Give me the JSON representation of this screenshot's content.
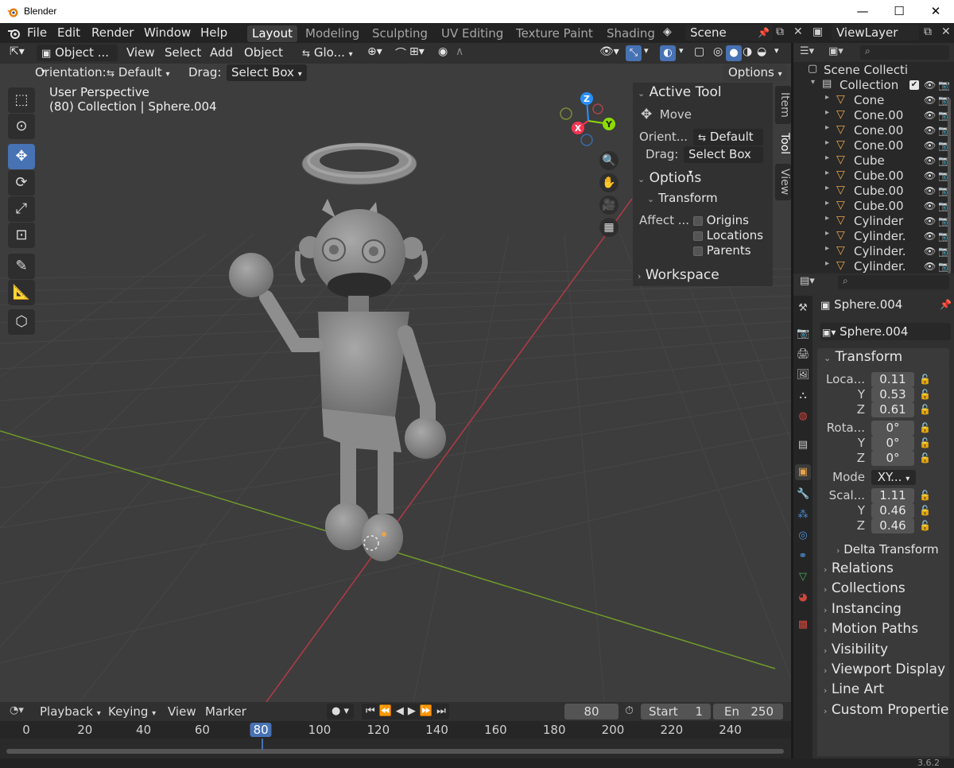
{
  "window": {
    "title": "Blender",
    "minimize": "—",
    "maximize": "☐",
    "close": "✕"
  },
  "menus": [
    "File",
    "Edit",
    "Render",
    "Window",
    "Help"
  ],
  "workspaces": [
    "Layout",
    "Modeling",
    "Sculpting",
    "UV Editing",
    "Texture Paint",
    "Shading"
  ],
  "active_workspace": "Layout",
  "scene": {
    "name": "Scene"
  },
  "viewlayer": {
    "name": "ViewLayer"
  },
  "viewport_header": {
    "mode": "Object ...",
    "menus": [
      "View",
      "Select",
      "Add",
      "Object"
    ],
    "transform_orientation": "Glo...",
    "orientation_label": "Orientation:",
    "orientation_value": "Default",
    "drag_label": "Drag:",
    "drag_value": "Select Box",
    "options_label": "Options"
  },
  "viewport_overlay": {
    "line1": "User Perspective",
    "line2": "(80) Collection | Sphere.004"
  },
  "gizmo": {
    "x": "X",
    "y": "Y",
    "z": "Z"
  },
  "npanel": {
    "active_tool_header": "Active Tool",
    "tool_name": "Move",
    "orient_label": "Orient...",
    "orient_value": "Default",
    "drag_label": "Drag:",
    "drag_value": "Select Box",
    "options_header": "Options",
    "transform_sub": "Transform",
    "affect_label": "Affect ...",
    "affect_options": [
      "Origins",
      "Locations",
      "Parents"
    ],
    "workspace_header": "Workspace",
    "tabs": [
      "Item",
      "Tool",
      "View"
    ],
    "active_tab": "Tool"
  },
  "outliner": {
    "scene_collection": "Scene Collecti",
    "collection": "Collection",
    "items": [
      "Cone",
      "Cone.00",
      "Cone.00",
      "Cone.00",
      "Cube",
      "Cube.00",
      "Cube.00",
      "Cube.00",
      "Cylinder",
      "Cylinder.",
      "Cylinder.",
      "Cylinder."
    ]
  },
  "properties": {
    "object_name": "Sphere.004",
    "data_name": "Sphere.004",
    "transform_header": "Transform",
    "location": {
      "label": "Loca...",
      "x": "0.11",
      "y": "0.53",
      "z": "0.61"
    },
    "rotation": {
      "label": "Rota...",
      "x": "0°",
      "y": "0°",
      "z": "0°"
    },
    "mode_label": "Mode",
    "mode_value": "XY...",
    "scale": {
      "label": "Scal...",
      "x": "1.11",
      "y": "0.46",
      "z": "0.46"
    },
    "axis_y": "Y",
    "axis_z": "Z",
    "delta_transform": "Delta Transform",
    "sections": [
      "Relations",
      "Collections",
      "Instancing",
      "Motion Paths",
      "Visibility",
      "Viewport Display",
      "Line Art",
      "Custom Propertie"
    ]
  },
  "timeline": {
    "menus": [
      "Playback",
      "Keying",
      "View",
      "Marker"
    ],
    "current_frame": "80",
    "start_label": "Start",
    "start_value": "1",
    "end_label": "En",
    "end_value": "250",
    "ruler": [
      "0",
      "20",
      "40",
      "60",
      "80",
      "100",
      "120",
      "140",
      "160",
      "180",
      "200",
      "220",
      "240"
    ]
  },
  "statusbar": {
    "version": "3.6.2"
  },
  "colors": {
    "accent": "#4772b3",
    "x_axis": "#ff3352",
    "y_axis": "#8bdc00",
    "z_axis": "#2890ff",
    "object_orange": "#e8a44b"
  }
}
